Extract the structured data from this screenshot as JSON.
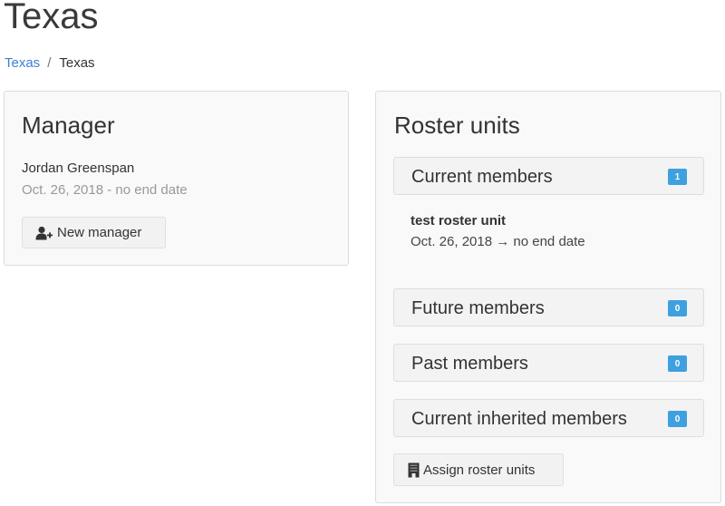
{
  "page": {
    "title": "Texas",
    "breadcrumb": [
      {
        "label": "Texas",
        "link": true
      },
      {
        "label": "Texas",
        "link": false
      }
    ],
    "breadcrumb_separator": "/"
  },
  "manager": {
    "heading": "Manager",
    "name": "Jordan Greenspan",
    "dates": "Oct. 26, 2018 - no end date",
    "new_button": {
      "label": "New manager",
      "icon": "user-plus-icon"
    }
  },
  "roster": {
    "heading": "Roster units",
    "sections": [
      {
        "label": "Current members",
        "count": "1"
      },
      {
        "label": "Future members",
        "count": "0"
      },
      {
        "label": "Past members",
        "count": "0"
      },
      {
        "label": "Current inherited members",
        "count": "0"
      }
    ],
    "current_members": [
      {
        "name": "test roster unit",
        "dates": "Oct. 26, 2018 → no end date"
      }
    ],
    "assign_button": {
      "label": "Assign roster units",
      "icon": "building-icon"
    },
    "badge_color": "#3fa0e0"
  },
  "colors": {
    "link": "#3d7fd6",
    "panel_bg": "#f9f9f9",
    "muted_text": "#999999"
  }
}
